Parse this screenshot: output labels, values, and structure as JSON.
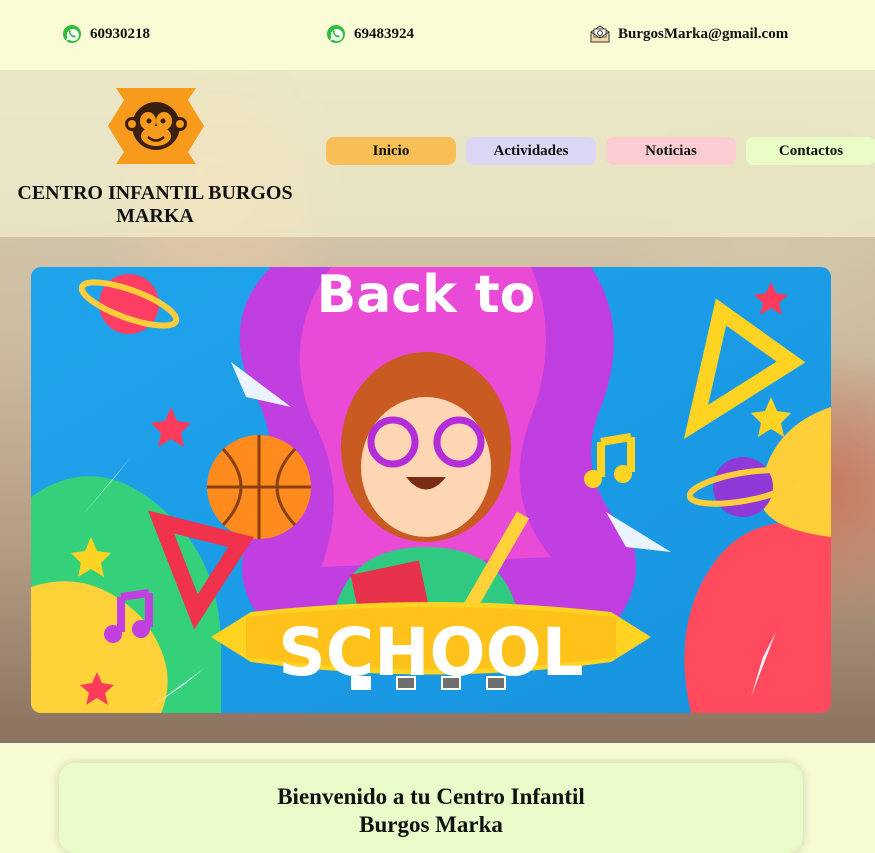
{
  "contacts": {
    "phone1": "60930218",
    "phone2": "69483924",
    "email": "BurgosMarka@gmail.com"
  },
  "site": {
    "title": "CENTRO INFANTIL BURGOS MARKA"
  },
  "nav": {
    "items": [
      {
        "label": "Inicio",
        "color": "#f7bf56"
      },
      {
        "label": "Actividades",
        "color": "#dad6f4"
      },
      {
        "label": "Noticias",
        "color": "#fbcdd2"
      },
      {
        "label": "Contactos",
        "color": "#e9fcc6"
      }
    ]
  },
  "carousel": {
    "image_text_top": "Back to",
    "image_text_bottom": "SCHOOL",
    "slides": 4,
    "active_slide": 1
  },
  "welcome": {
    "line1": "Bienvenido a tu Centro Infantil",
    "line2": "Burgos Marka"
  },
  "colors": {
    "page_bg": "#f7fbd3",
    "welcome_bg": "#e8fbc8",
    "logo_orange": "#f89b1c"
  }
}
